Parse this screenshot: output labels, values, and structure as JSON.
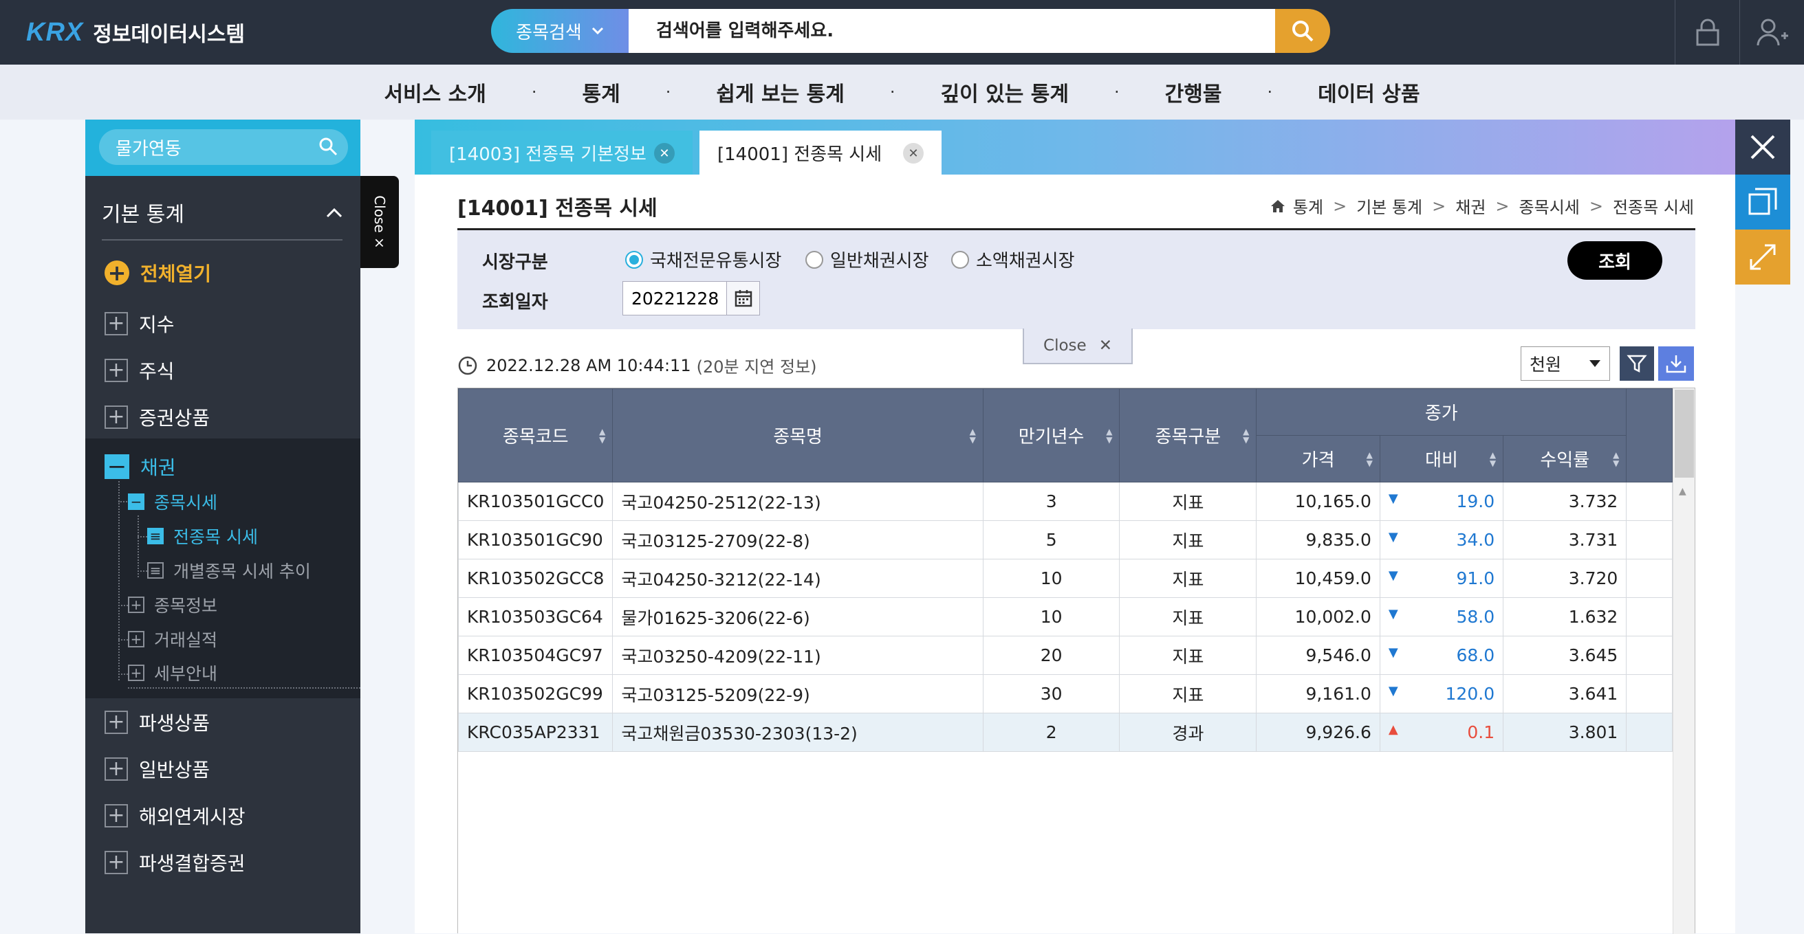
{
  "header": {
    "logo_text": "KRX",
    "system_name": "정보데이터시스템",
    "search_type": "종목검색",
    "search_placeholder": "검색어를 입력해주세요."
  },
  "menu": [
    "서비스 소개",
    "통계",
    "쉽게 보는 통계",
    "깊이 있는 통계",
    "간행물",
    "데이터 상품"
  ],
  "menu_separator": "·",
  "sidebar": {
    "search_value": "물가연동",
    "section_title": "기본 통계",
    "expand_all": "전체열기",
    "items": [
      "지수",
      "주식",
      "증권상품",
      "채권",
      "파생상품",
      "일반상품",
      "해외연계시장",
      "파생결합증권"
    ],
    "bond_sub": [
      "종목시세",
      "전종목 시세",
      "개별종목 시세 추이",
      "종목정보",
      "거래실적",
      "세부안내"
    ],
    "close_tab": "Close ×"
  },
  "tabs": [
    {
      "label": "[14003] 전종목 기본정보"
    },
    {
      "label": "[14001] 전종목 시세"
    }
  ],
  "page": {
    "title": "[14001] 전종목 시세",
    "breadcrumb": [
      "통계",
      "기본 통계",
      "채권",
      "종목시세",
      "전종목 시세"
    ]
  },
  "filter": {
    "market_label": "시장구분",
    "market_options": [
      "국채전문유통시장",
      "일반채권시장",
      "소액채권시장"
    ],
    "market_selected": "국채전문유통시장",
    "date_label": "조회일자",
    "date_value": "20221228",
    "query_button": "조회",
    "close_label": "Close"
  },
  "timestamp": "2022.12.28 AM 10:44:11",
  "delay_note": "(20분 지연 정보)",
  "unit": "천원",
  "table": {
    "headers": {
      "code": "종목코드",
      "name": "종목명",
      "maturity": "만기년수",
      "type": "종목구분",
      "close_group": "종가",
      "price": "가격",
      "change": "대비",
      "yield": "수익률"
    },
    "rows": [
      {
        "code": "KR103501GCC0",
        "name": "국고04250-2512(22-13)",
        "maturity": "3",
        "type": "지표",
        "price": "10,165.0",
        "dir": "down",
        "change": "19.0",
        "yield": "3.732"
      },
      {
        "code": "KR103501GC90",
        "name": "국고03125-2709(22-8)",
        "maturity": "5",
        "type": "지표",
        "price": "9,835.0",
        "dir": "down",
        "change": "34.0",
        "yield": "3.731"
      },
      {
        "code": "KR103502GCC8",
        "name": "국고04250-3212(22-14)",
        "maturity": "10",
        "type": "지표",
        "price": "10,459.0",
        "dir": "down",
        "change": "91.0",
        "yield": "3.720"
      },
      {
        "code": "KR103503GC64",
        "name": "물가01625-3206(22-6)",
        "maturity": "10",
        "type": "지표",
        "price": "10,002.0",
        "dir": "down",
        "change": "58.0",
        "yield": "1.632"
      },
      {
        "code": "KR103504GC97",
        "name": "국고03250-4209(22-11)",
        "maturity": "20",
        "type": "지표",
        "price": "9,546.0",
        "dir": "down",
        "change": "68.0",
        "yield": "3.645"
      },
      {
        "code": "KR103502GC99",
        "name": "국고03125-5209(22-9)",
        "maturity": "30",
        "type": "지표",
        "price": "9,161.0",
        "dir": "down",
        "change": "120.0",
        "yield": "3.641"
      },
      {
        "code": "KRC035AP2331",
        "name": "국고채원금03530-2303(13-2)",
        "maturity": "2",
        "type": "경과",
        "price": "9,926.6",
        "dir": "up",
        "change": "0.1",
        "yield": "3.801"
      }
    ]
  },
  "colors": {
    "topbar": "#29313e",
    "accent_cyan": "#23b2dc",
    "accent_orange": "#e5a12e",
    "down": "#1f78d1",
    "up": "#e84d3d",
    "table_header": "#5d6b86"
  }
}
